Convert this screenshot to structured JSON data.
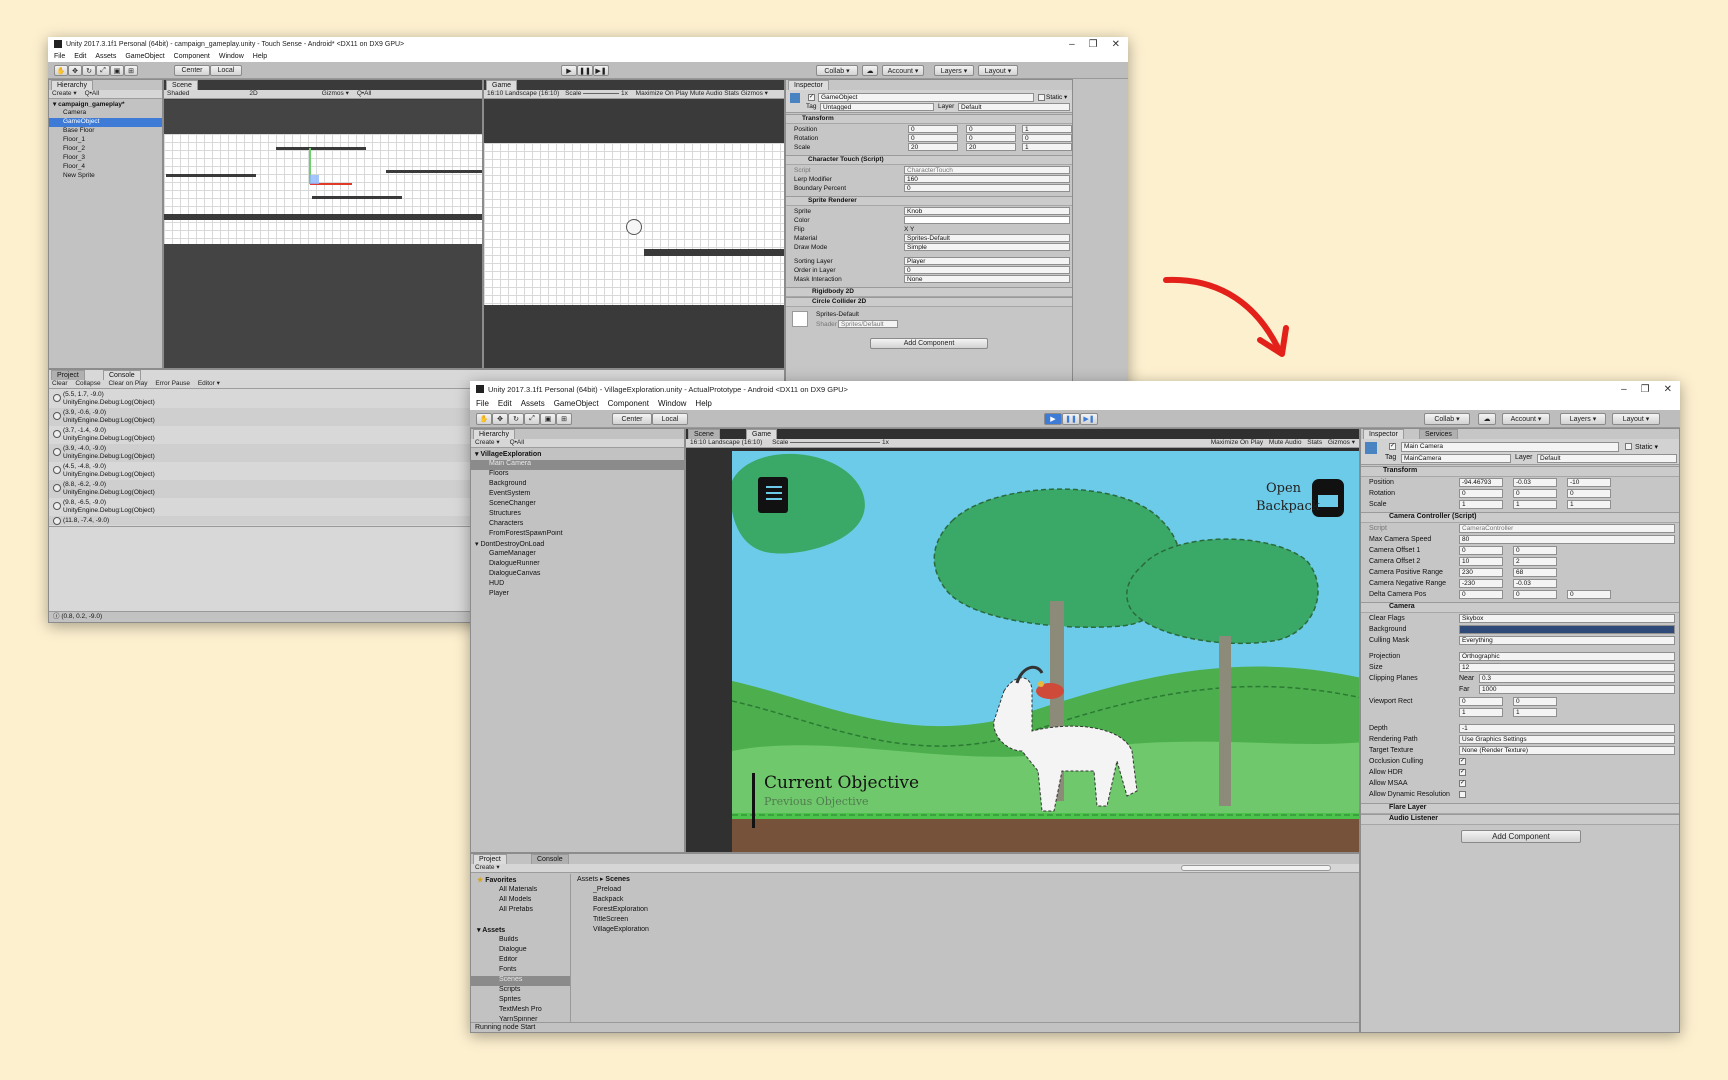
{
  "w1": {
    "title": "Unity 2017.3.1f1 Personal (64bit) - campaign_gameplay.unity - Touch Sense - Android* <DX11 on DX9 GPU>",
    "menu": [
      "File",
      "Edit",
      "Assets",
      "GameObject",
      "Component",
      "Window",
      "Help"
    ],
    "toolbar": {
      "center": "Center",
      "local": "Local",
      "collab": "Collab ▾",
      "account": "Account ▾",
      "layers": "Layers ▾",
      "layout": "Layout ▾"
    },
    "hierarchy": {
      "tab": "Hierarchy",
      "create": "Create ▾",
      "search": "Q•All",
      "scene_name": "campaign_gameplay*",
      "items": [
        "Camera",
        "GameObject",
        "Base Floor",
        "Floor_1",
        "Floor_2",
        "Floor_3",
        "Floor_4",
        "New Sprite"
      ]
    },
    "scene": {
      "tab": "Scene",
      "shaded": "Shaded",
      "mode2d": "2D",
      "gizmos": "Gizmos ▾",
      "search": "Q•All"
    },
    "game": {
      "tab": "Game",
      "aspect": "16:10 Landscape (16:10)",
      "scale_label": "Scale",
      "scale_val": "1x",
      "max": "Maximize On Play",
      "mute": "Mute Audio",
      "stats": "Stats",
      "gizmos": "Gizmos ▾"
    },
    "console": {
      "tabs": [
        "Project",
        "Console"
      ],
      "buttons": [
        "Clear",
        "Collapse",
        "Clear on Play",
        "Error Pause",
        "Editor ▾"
      ],
      "logs": [
        {
          "l1": "(5.5, 1.7, -9.0)",
          "l2": "UnityEngine.Debug:Log(Object)"
        },
        {
          "l1": "(3.9, -0.6, -9.0)",
          "l2": "UnityEngine.Debug:Log(Object)"
        },
        {
          "l1": "(3.7, -1.4, -9.0)",
          "l2": "UnityEngine.Debug:Log(Object)"
        },
        {
          "l1": "(3.9, -4.0, -9.0)",
          "l2": "UnityEngine.Debug:Log(Object)"
        },
        {
          "l1": "(4.5, -4.8, -9.0)",
          "l2": "UnityEngine.Debug:Log(Object)"
        },
        {
          "l1": "(8.8, -6.2, -9.0)",
          "l2": "UnityEngine.Debug:Log(Object)"
        },
        {
          "l1": "(9.8, -6.5, -9.0)",
          "l2": "UnityEngine.Debug:Log(Object)"
        },
        {
          "l1": "(11.8, -7.4, -9.0)",
          "l2": ""
        }
      ],
      "status": "(0.8, 0.2, -9.0)"
    },
    "inspector": {
      "tab": "Inspector",
      "name": "GameObject",
      "static": "Static ▾",
      "tag_label": "Tag",
      "tag": "Untagged",
      "layer_label": "Layer",
      "layer": "Default",
      "transform": {
        "title": "Transform",
        "pos": "Position",
        "rot": "Rotation",
        "scale": "Scale",
        "px": "0",
        "py": "0",
        "pz": "1",
        "rx": "0",
        "ry": "0",
        "rz": "0",
        "sx": "20",
        "sy": "20",
        "sz": "1"
      },
      "ct": {
        "title": "Character Touch (Script)",
        "script_l": "Script",
        "script": "CharacterTouch",
        "lerp_l": "Lerp Modifier",
        "lerp": "160",
        "boundary_l": "Boundary Percent",
        "boundary": "0"
      },
      "sr": {
        "title": "Sprite Renderer",
        "sprite_l": "Sprite",
        "sprite": "Knob",
        "color_l": "Color",
        "flip_l": "Flip",
        "flip": "X    Y",
        "mat_l": "Material",
        "mat": "Sprites-Default",
        "draw_l": "Draw Mode",
        "draw": "Simple",
        "sort_l": "Sorting Layer",
        "sort": "Player",
        "order_l": "Order in Layer",
        "order": "0",
        "mask_l": "Mask Interaction",
        "mask": "None"
      },
      "rb": "Rigidbody 2D",
      "cc": "Circle Collider 2D",
      "material_name": "Sprites-Default",
      "shader_l": "Shader",
      "shader": "Sprites/Default",
      "add": "Add Component"
    }
  },
  "w2": {
    "title": "Unity 2017.3.1f1 Personal (64bit) - VillageExploration.unity - ActualPrototype - Android <DX11 on DX9 GPU>",
    "menu": [
      "File",
      "Edit",
      "Assets",
      "GameObject",
      "Component",
      "Window",
      "Help"
    ],
    "toolbar": {
      "center": "Center",
      "local": "Local",
      "collab": "Collab ▾",
      "account": "Account ▾",
      "layers": "Layers ▾",
      "layout": "Layout ▾"
    },
    "hierarchy": {
      "tab": "Hierarchy",
      "create": "Create ▾",
      "search": "Q•All",
      "scene1": "VillageExploration",
      "items1": [
        "Main Camera",
        "Floors",
        "Background",
        "EventSystem",
        "SceneChanger",
        "Structures",
        "Characters",
        "FromForestSpawnPoint"
      ],
      "scene2": "DontDestroyOnLoad",
      "items2": [
        "GameManager",
        "DialogueRunner",
        "DialogueCanvas",
        "HUD",
        "Player"
      ]
    },
    "game": {
      "tabs": [
        "Scene",
        "Game"
      ],
      "aspect": "16:10 Landscape (16:10)",
      "scale_label": "Scale",
      "scale_val": "1x",
      "max": "Maximize On Play",
      "mute": "Mute Audio",
      "stats": "Stats",
      "gizmos": "Gizmos ▾",
      "open": "Open",
      "backpack": "Backpack",
      "objective": "Current Objective",
      "prev": "Previous Objective"
    },
    "project": {
      "tabs": [
        "Project",
        "Console"
      ],
      "create": "Create ▾",
      "favorites": "Favorites",
      "fav_items": [
        "All Materials",
        "All Models",
        "All Prefabs"
      ],
      "assets": "Assets",
      "asset_items": [
        "Builds",
        "Dialogue",
        "Editor",
        "Fonts",
        "Scenes",
        "Scripts",
        "Sprites",
        "TextMesh Pro",
        "YarnSpinner"
      ],
      "crumb1": "Assets",
      "crumb2": "Scenes",
      "files": [
        "_Preload",
        "Backpack",
        "ForestExploration",
        "TitleScreen",
        "VillageExploration"
      ],
      "status": "Running node Start"
    },
    "inspector": {
      "tabs": [
        "Inspector",
        "Services"
      ],
      "name": "Main Camera",
      "static": "Static ▾",
      "tag_label": "Tag",
      "tag": "MainCamera",
      "layer_label": "Layer",
      "layer": "Default",
      "transform": {
        "title": "Transform",
        "pos": "Position",
        "rot": "Rotation",
        "scale": "Scale",
        "px": "-94.46793",
        "py": "-0.03",
        "pz": "-10",
        "rx": "0",
        "ry": "0",
        "rz": "0",
        "sx": "1",
        "sy": "1",
        "sz": "1"
      },
      "cc": {
        "title": "Camera Controller (Script)",
        "script_l": "Script",
        "script": "CameraController",
        "speed_l": "Max Camera Speed",
        "speed": "80",
        "o1_l": "Camera Offset 1",
        "o1x": "0",
        "o1y": "0",
        "o2_l": "Camera Offset 2",
        "o2x": "10",
        "o2y": "2",
        "pr_l": "Camera Positive Range",
        "prx": "230",
        "pry": "68",
        "nr_l": "Camera Negative Range",
        "nrx": "-230",
        "nry": "-0.03",
        "dp_l": "Delta Camera Pos",
        "dpx": "0",
        "dpy": "0",
        "dpz": "0"
      },
      "cam": {
        "title": "Camera",
        "clear_l": "Clear Flags",
        "clear": "Skybox",
        "bg_l": "Background",
        "cull_l": "Culling Mask",
        "cull": "Everything",
        "proj_l": "Projection",
        "proj": "Orthographic",
        "size_l": "Size",
        "size": "12",
        "clip_l": "Clipping Planes",
        "near_l": "Near",
        "near": "0.3",
        "far_l": "Far",
        "far": "1000",
        "vp_l": "Viewport Rect",
        "vx": "0",
        "vy": "0",
        "vw": "1",
        "vh": "1",
        "depth_l": "Depth",
        "depth": "-1",
        "rp_l": "Rendering Path",
        "rp": "Use Graphics Settings",
        "tt_l": "Target Texture",
        "tt": "None (Render Texture)",
        "oc_l": "Occlusion Culling",
        "hdr_l": "Allow HDR",
        "msaa_l": "Allow MSAA",
        "dyn_l": "Allow Dynamic Resolution"
      },
      "flare": "Flare Layer",
      "audio": "Audio Listener",
      "add": "Add Component"
    }
  },
  "colors": {
    "bg": "#fdf0cf",
    "arrow": "#e3211a",
    "selection": "#3d7bd6",
    "sky": "#6ccbe9",
    "grass": "#5bb85a",
    "tree": "#3aa866",
    "dirt": "#77523a"
  }
}
